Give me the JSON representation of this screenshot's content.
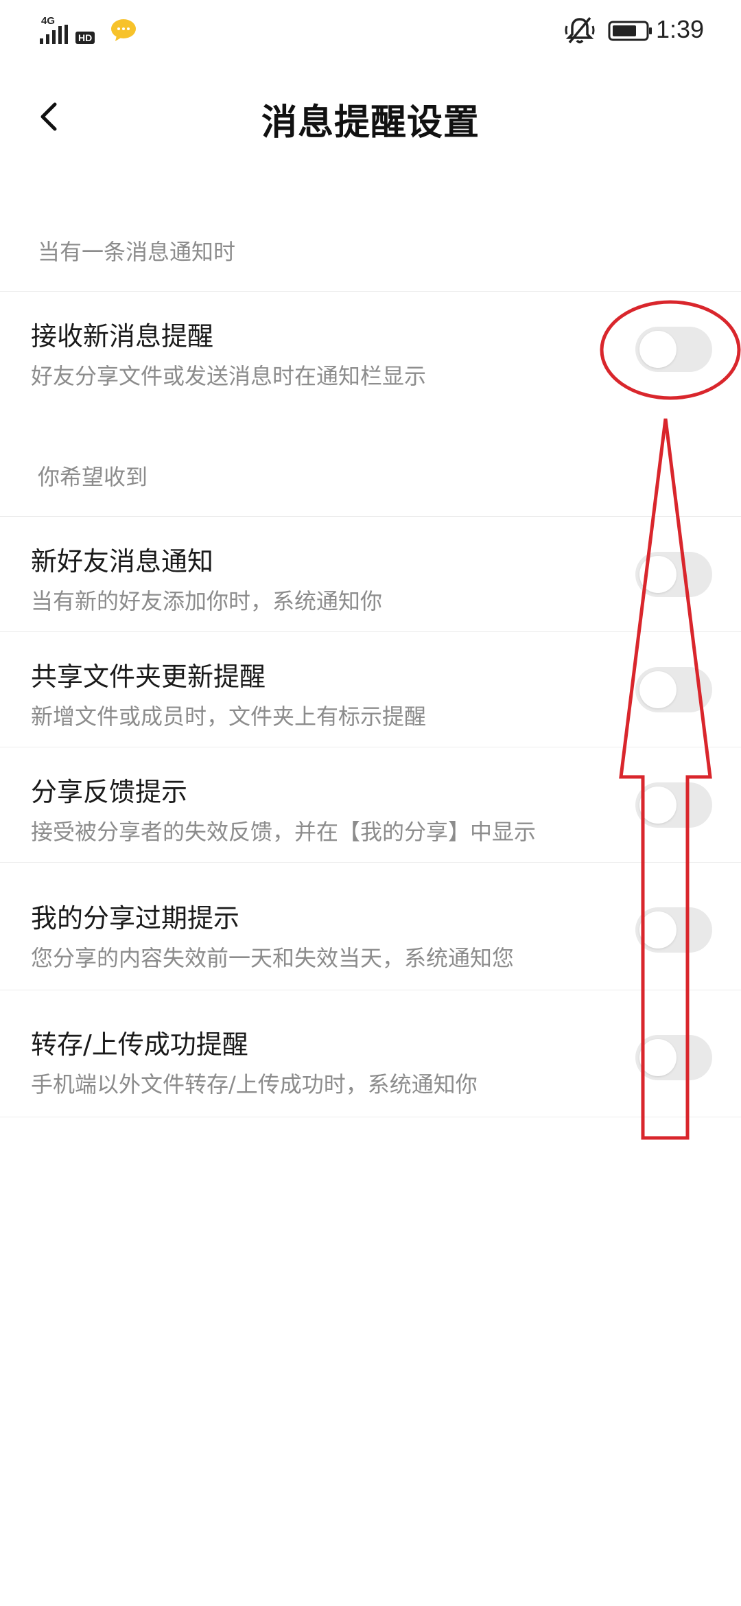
{
  "status_bar": {
    "network": "4G",
    "hd_badge": "HD",
    "time": "1:39",
    "icons": [
      "signal-icon",
      "chat-bubble-icon",
      "mute-bell-icon",
      "battery-icon"
    ]
  },
  "header": {
    "title": "消息提醒设置",
    "back_icon": "chevron-left-icon"
  },
  "sections": [
    {
      "header": "当有一条消息通知时",
      "items": [
        {
          "title": "接收新消息提醒",
          "desc": "好友分享文件或发送消息时在通知栏显示",
          "enabled": false
        }
      ]
    },
    {
      "header": "你希望收到",
      "items": [
        {
          "title": "新好友消息通知",
          "desc": "当有新的好友添加你时，系统通知你",
          "enabled": false
        },
        {
          "title": "共享文件夹更新提醒",
          "desc": "新增文件或成员时，文件夹上有标示提醒",
          "enabled": false
        },
        {
          "title": "分享反馈提示",
          "desc": "接受被分享者的失效反馈，并在【我的分享】中显示",
          "enabled": false
        },
        {
          "title": "我的分享过期提示",
          "desc": "您分享的内容失效前一天和失效当天，系统通知您",
          "enabled": false
        },
        {
          "title": "转存/上传成功提醒",
          "desc": "手机端以外文件转存/上传成功时，系统通知你",
          "enabled": false
        }
      ]
    }
  ],
  "colors": {
    "annotation": "#d9262c",
    "toggle_off": "#e9e9e9",
    "secondary_text": "#8c8c8c"
  }
}
